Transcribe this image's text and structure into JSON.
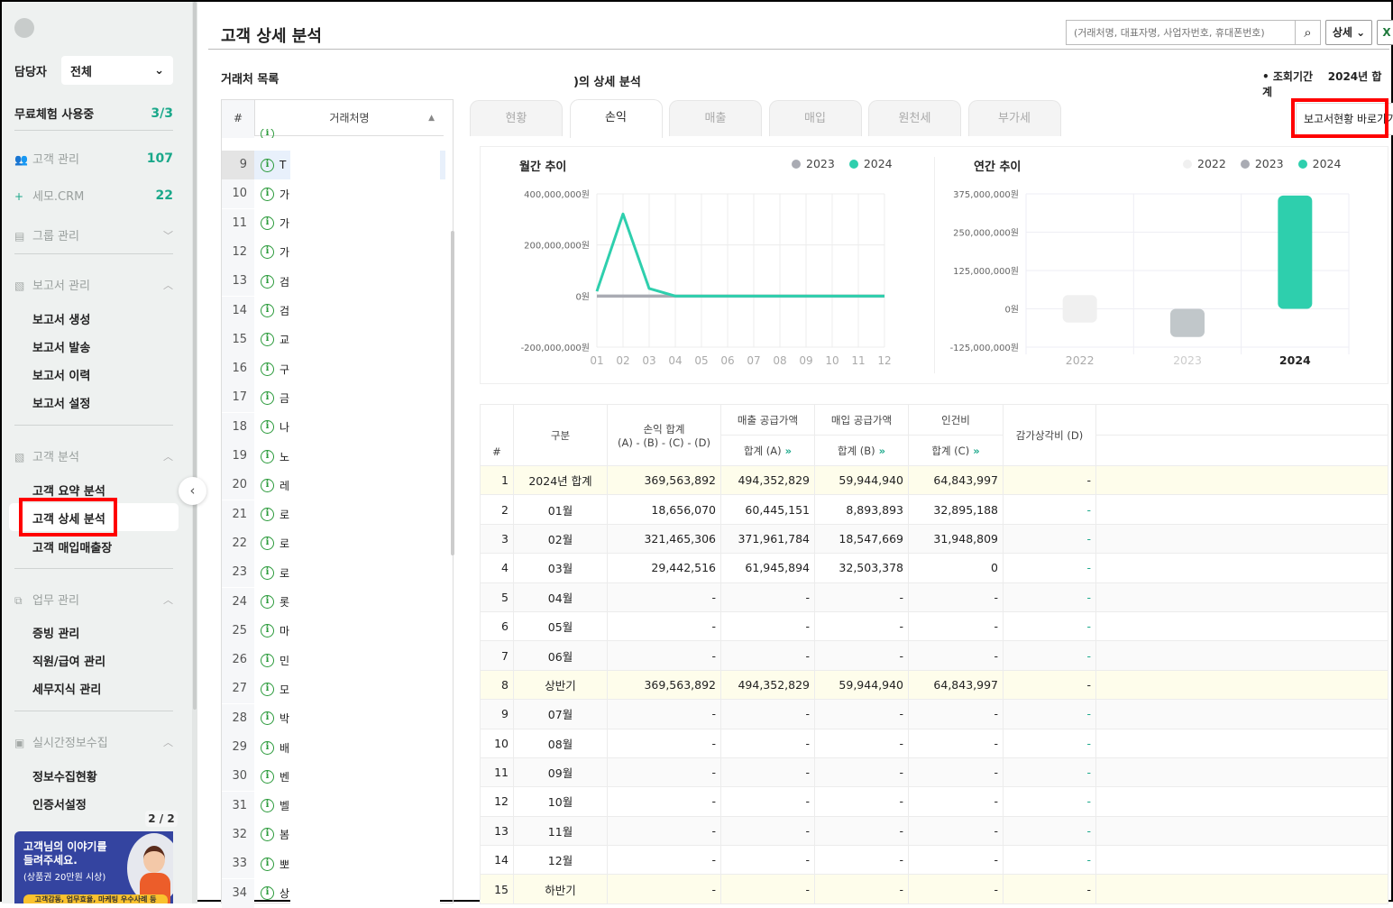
{
  "sidebar": {
    "manager_label": "담당자",
    "manager_value": "전체",
    "trial_label": "무료체험 사용중",
    "trial_count": "3/3",
    "customer_mgmt": "고객 관리",
    "customer_count": "107",
    "semo_crm": "세모.CRM",
    "semo_count": "22",
    "group_mgmt": "그룹 관리",
    "report_mgmt": "보고서 관리",
    "report_items": [
      "보고서 생성",
      "보고서 발송",
      "보고서 이력",
      "보고서 설정"
    ],
    "analysis": "고객 분석",
    "analysis_items": [
      "고객 요약 분석",
      "고객 상세 분석",
      "고객 매입매출장"
    ],
    "work_mgmt": "업무 관리",
    "work_items": [
      "증빙 관리",
      "직원/급여 관리",
      "세무지식 관리"
    ],
    "realtime": "실시간정보수집",
    "realtime_items": [
      "정보수집현황",
      "인증서설정"
    ],
    "banner_page": "2 / 2",
    "banner": {
      "line1": "고객님의 이야기를",
      "line2": "들려주세요.",
      "line3": "(상품권 20만원 시상)",
      "ribbon": "고객감동, 업무효율, 마케팅 우수사례 등"
    }
  },
  "header": {
    "title": "고객 상세 분석",
    "search_placeholder": "(거래처명, 대표자명, 사업자번호, 휴대폰번호)",
    "detail_button": "상세",
    "excel": "X"
  },
  "list": {
    "title": "거래처 목록",
    "col_num": "#",
    "col_name": "거래처명",
    "rows": [
      {
        "n": "9",
        "t": "T"
      },
      {
        "n": "10",
        "t": "가"
      },
      {
        "n": "11",
        "t": "가"
      },
      {
        "n": "12",
        "t": "가"
      },
      {
        "n": "13",
        "t": "검"
      },
      {
        "n": "14",
        "t": "검"
      },
      {
        "n": "15",
        "t": "교"
      },
      {
        "n": "16",
        "t": "구"
      },
      {
        "n": "17",
        "t": "금"
      },
      {
        "n": "18",
        "t": "나"
      },
      {
        "n": "19",
        "t": "노"
      },
      {
        "n": "20",
        "t": "레"
      },
      {
        "n": "21",
        "t": "로"
      },
      {
        "n": "22",
        "t": "로"
      },
      {
        "n": "23",
        "t": "로"
      },
      {
        "n": "24",
        "t": "롯"
      },
      {
        "n": "25",
        "t": "마"
      },
      {
        "n": "26",
        "t": "민"
      },
      {
        "n": "27",
        "t": "모"
      },
      {
        "n": "28",
        "t": "박"
      },
      {
        "n": "29",
        "t": "배"
      },
      {
        "n": "30",
        "t": "벤"
      },
      {
        "n": "31",
        "t": "벨"
      },
      {
        "n": "32",
        "t": "봄"
      },
      {
        "n": "33",
        "t": "뽀"
      },
      {
        "n": "34",
        "t": "상"
      }
    ]
  },
  "detail": {
    "title": ")의 상세 분석",
    "period_label": "조회기간",
    "period_value": "2024년 합계",
    "report_link": "보고서현황 바로가기",
    "tabs": [
      "현황",
      "손익",
      "매출",
      "매입",
      "원천세",
      "부가세"
    ],
    "active_tab": "손익"
  },
  "colors": {
    "accent": "#1aa88a",
    "series2024": "#2ecfad",
    "series2023": "#a9abb3",
    "series2022": "#f0f0f0",
    "highlight": "#ff0000"
  },
  "chart_data": [
    {
      "type": "line",
      "title": "월간 추이",
      "x": [
        "01",
        "02",
        "03",
        "04",
        "05",
        "06",
        "07",
        "08",
        "09",
        "10",
        "11",
        "12"
      ],
      "yticks": [
        "400,000,000원",
        "200,000,000원",
        "0원",
        "-200,000,000원"
      ],
      "ylim": [
        -200000000,
        400000000
      ],
      "grid": true,
      "legend": "top-right",
      "series": [
        {
          "name": "2023",
          "values": [
            0,
            0,
            0,
            0,
            0,
            0,
            0,
            0,
            0,
            0,
            0,
            0
          ]
        },
        {
          "name": "2024",
          "values": [
            18656070,
            321465306,
            29442516,
            0,
            0,
            0,
            0,
            0,
            0,
            0,
            0,
            0
          ]
        }
      ]
    },
    {
      "type": "bar",
      "title": "연간 추이",
      "categories": [
        "2022",
        "2023",
        "2024"
      ],
      "yticks": [
        "375,000,000원",
        "250,000,000원",
        "125,000,000원",
        "0원",
        "-125,000,000원"
      ],
      "ylim": [
        -125000000,
        375000000
      ],
      "grid": true,
      "legend": "top-right",
      "series": [
        {
          "name": "2022",
          "values": [
            -45000000
          ]
        },
        {
          "name": "2023",
          "values": [
            -92000000
          ]
        },
        {
          "name": "2024",
          "values": [
            369563892
          ]
        }
      ]
    }
  ],
  "table": {
    "headers": {
      "num": "#",
      "cat": "구분",
      "pl": "손익 합계",
      "pl_formula": "(A) - (B) - (C) - (D)",
      "sales": "매출 공급가액",
      "sales_sub": "합계 (A)",
      "purchase": "매입 공급가액",
      "purchase_sub": "합계 (B)",
      "labor": "인건비",
      "labor_sub": "합계 (C)",
      "dep": "감가상각비 (D)"
    },
    "rows": [
      [
        "1",
        "2024년 합계",
        "369,563,892",
        "494,352,829",
        "59,944,940",
        "64,843,997",
        "-"
      ],
      [
        "2",
        "01월",
        "18,656,070",
        "60,445,151",
        "8,893,893",
        "32,895,188",
        "-"
      ],
      [
        "3",
        "02월",
        "321,465,306",
        "371,961,784",
        "18,547,669",
        "31,948,809",
        "-"
      ],
      [
        "4",
        "03월",
        "29,442,516",
        "61,945,894",
        "32,503,378",
        "0",
        "-"
      ],
      [
        "5",
        "04월",
        "-",
        "-",
        "-",
        "-",
        "-"
      ],
      [
        "6",
        "05월",
        "-",
        "-",
        "-",
        "-",
        "-"
      ],
      [
        "7",
        "06월",
        "-",
        "-",
        "-",
        "-",
        "-"
      ],
      [
        "8",
        "상반기",
        "369,563,892",
        "494,352,829",
        "59,944,940",
        "64,843,997",
        "-"
      ],
      [
        "9",
        "07월",
        "-",
        "-",
        "-",
        "-",
        "-"
      ],
      [
        "10",
        "08월",
        "-",
        "-",
        "-",
        "-",
        "-"
      ],
      [
        "11",
        "09월",
        "-",
        "-",
        "-",
        "-",
        "-"
      ],
      [
        "12",
        "10월",
        "-",
        "-",
        "-",
        "-",
        "-"
      ],
      [
        "13",
        "11월",
        "-",
        "-",
        "-",
        "-",
        "-"
      ],
      [
        "14",
        "12월",
        "-",
        "-",
        "-",
        "-",
        "-"
      ],
      [
        "15",
        "하반기",
        "-",
        "-",
        "-",
        "-",
        "-"
      ]
    ]
  }
}
